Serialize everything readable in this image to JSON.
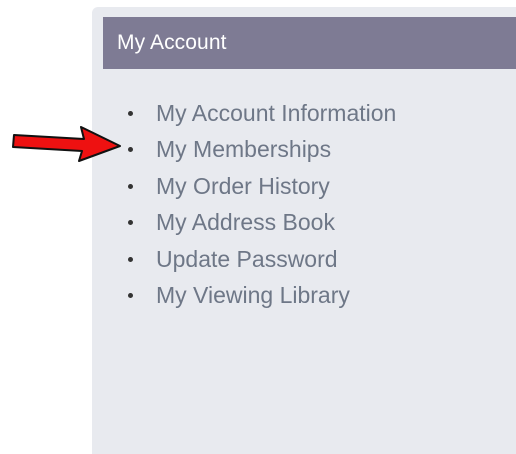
{
  "panel": {
    "title": "My Account"
  },
  "menu": {
    "items": [
      {
        "label": "My Account Information"
      },
      {
        "label": "My Memberships"
      },
      {
        "label": "My Order History"
      },
      {
        "label": "My Address Book"
      },
      {
        "label": "Update Password"
      },
      {
        "label": "My Viewing Library"
      }
    ]
  },
  "annotation": {
    "icon": "red-arrow-icon",
    "points_to": "My Memberships"
  },
  "colors": {
    "panel_background": "#e8eaef",
    "header_background": "#7e7b94",
    "header_text": "#ffffff",
    "link_text": "#6e7787",
    "arrow_fill": "#ee1111"
  }
}
